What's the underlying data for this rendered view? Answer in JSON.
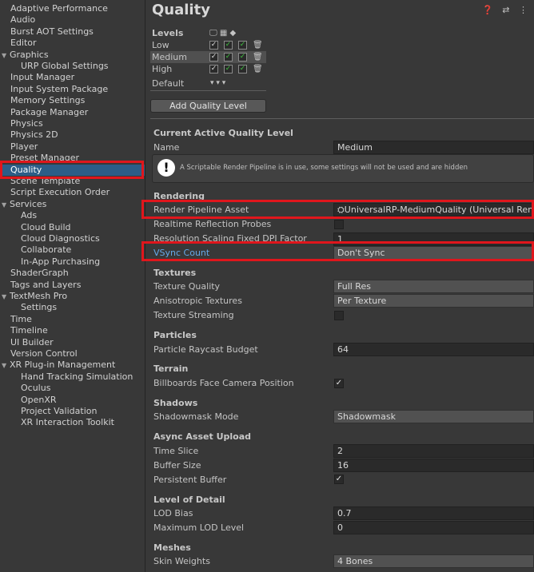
{
  "sidebar": {
    "items": [
      {
        "label": "Adaptive Performance",
        "indent": 0,
        "arrow": ""
      },
      {
        "label": "Audio",
        "indent": 0,
        "arrow": ""
      },
      {
        "label": "Burst AOT Settings",
        "indent": 0,
        "arrow": ""
      },
      {
        "label": "Editor",
        "indent": 0,
        "arrow": ""
      },
      {
        "label": "Graphics",
        "indent": 0,
        "arrow": "▼"
      },
      {
        "label": "URP Global Settings",
        "indent": 1,
        "arrow": ""
      },
      {
        "label": "Input Manager",
        "indent": 0,
        "arrow": ""
      },
      {
        "label": "Input System Package",
        "indent": 0,
        "arrow": ""
      },
      {
        "label": "Memory Settings",
        "indent": 0,
        "arrow": ""
      },
      {
        "label": "Package Manager",
        "indent": 0,
        "arrow": ""
      },
      {
        "label": "Physics",
        "indent": 0,
        "arrow": ""
      },
      {
        "label": "Physics 2D",
        "indent": 0,
        "arrow": ""
      },
      {
        "label": "Player",
        "indent": 0,
        "arrow": ""
      },
      {
        "label": "Preset Manager",
        "indent": 0,
        "arrow": ""
      },
      {
        "label": "Quality",
        "indent": 0,
        "arrow": "",
        "selected": true
      },
      {
        "label": "Scene Template",
        "indent": 0,
        "arrow": ""
      },
      {
        "label": "Script Execution Order",
        "indent": 0,
        "arrow": ""
      },
      {
        "label": "Services",
        "indent": 0,
        "arrow": "▼"
      },
      {
        "label": "Ads",
        "indent": 1,
        "arrow": ""
      },
      {
        "label": "Cloud Build",
        "indent": 1,
        "arrow": ""
      },
      {
        "label": "Cloud Diagnostics",
        "indent": 1,
        "arrow": ""
      },
      {
        "label": "Collaborate",
        "indent": 1,
        "arrow": ""
      },
      {
        "label": "In-App Purchasing",
        "indent": 1,
        "arrow": ""
      },
      {
        "label": "ShaderGraph",
        "indent": 0,
        "arrow": ""
      },
      {
        "label": "Tags and Layers",
        "indent": 0,
        "arrow": ""
      },
      {
        "label": "TextMesh Pro",
        "indent": 0,
        "arrow": "▼"
      },
      {
        "label": "Settings",
        "indent": 1,
        "arrow": ""
      },
      {
        "label": "Time",
        "indent": 0,
        "arrow": ""
      },
      {
        "label": "Timeline",
        "indent": 0,
        "arrow": ""
      },
      {
        "label": "UI Builder",
        "indent": 0,
        "arrow": ""
      },
      {
        "label": "Version Control",
        "indent": 0,
        "arrow": ""
      },
      {
        "label": "XR Plug-in Management",
        "indent": 0,
        "arrow": "▼"
      },
      {
        "label": "Hand Tracking Simulation",
        "indent": 1,
        "arrow": ""
      },
      {
        "label": "Oculus",
        "indent": 1,
        "arrow": ""
      },
      {
        "label": "OpenXR",
        "indent": 1,
        "arrow": ""
      },
      {
        "label": "Project Validation",
        "indent": 1,
        "arrow": ""
      },
      {
        "label": "XR Interaction Toolkit",
        "indent": 1,
        "arrow": ""
      }
    ]
  },
  "header": {
    "title": "Quality",
    "icons": "❓ ⇄ ⋮"
  },
  "levels": {
    "title": "Levels",
    "platform_icons": "🖵 ▦ ◆",
    "rows": [
      {
        "name": "Low"
      },
      {
        "name": "Medium",
        "selected": true
      },
      {
        "name": "High"
      }
    ],
    "default_label": "Default",
    "default_arrows": "▾  ▾  ▾",
    "add_button": "Add Quality Level"
  },
  "current": {
    "section": "Current Active Quality Level",
    "name_label": "Name",
    "name_value": "Medium",
    "help_text": "A Scriptable Render Pipeline is in use, some settings will not be used and are hidden"
  },
  "rendering": {
    "section": "Rendering",
    "rpa_label": "Render Pipeline Asset",
    "rpa_value": "⛭UniversalRP-MediumQuality (Universal Render",
    "rrp_label": "Realtime Reflection Probes",
    "rsf_label": "Resolution Scaling Fixed DPI Factor",
    "rsf_value": "1",
    "vsync_label": "VSync Count",
    "vsync_value": "Don't Sync"
  },
  "textures": {
    "section": "Textures",
    "tq_label": "Texture Quality",
    "tq_value": "Full Res",
    "at_label": "Anisotropic Textures",
    "at_value": "Per Texture",
    "ts_label": "Texture Streaming"
  },
  "particles": {
    "section": "Particles",
    "prb_label": "Particle Raycast Budget",
    "prb_value": "64"
  },
  "terrain": {
    "section": "Terrain",
    "bfc_label": "Billboards Face Camera Position"
  },
  "shadows": {
    "section": "Shadows",
    "sm_label": "Shadowmask Mode",
    "sm_value": "Shadowmask"
  },
  "async": {
    "section": "Async Asset Upload",
    "ts_label": "Time Slice",
    "ts_value": "2",
    "bs_label": "Buffer Size",
    "bs_value": "16",
    "pb_label": "Persistent Buffer"
  },
  "lod": {
    "section": "Level of Detail",
    "bias_label": "LOD Bias",
    "bias_value": "0.7",
    "max_label": "Maximum LOD Level",
    "max_value": "0"
  },
  "meshes": {
    "section": "Meshes",
    "sw_label": "Skin Weights",
    "sw_value": "4 Bones"
  },
  "check_glyph": "✓",
  "trash_glyph": "🗑",
  "help_glyph": "!"
}
